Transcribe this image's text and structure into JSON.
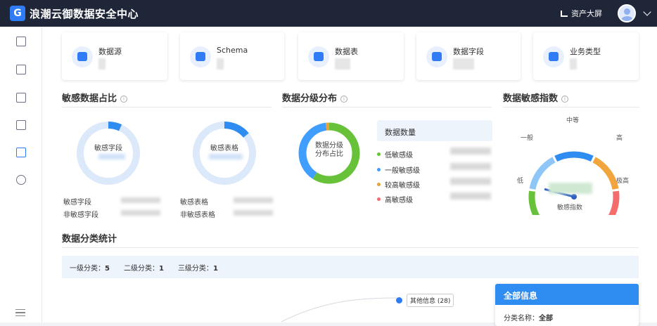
{
  "header": {
    "logo_letter": "G",
    "title": "浪潮云御数据安全中心",
    "big_screen_label": "资产大屏"
  },
  "sidebar": {
    "icons": [
      "dashboard-icon",
      "report-icon",
      "classification-icon",
      "copy-icon",
      "database-icon",
      "settings-icon"
    ],
    "active_index": 4
  },
  "cards": [
    {
      "label": "数据源",
      "icon": "datasource-icon"
    },
    {
      "label": "Schema",
      "icon": "schema-icon"
    },
    {
      "label": "数据表",
      "icon": "table-icon"
    },
    {
      "label": "数据字段",
      "icon": "field-icon"
    },
    {
      "label": "业务类型",
      "icon": "business-type-icon"
    }
  ],
  "sensitive_ratio": {
    "title": "敏感数据占比",
    "field_donut_label": "敏感字段",
    "table_donut_label": "敏感表格",
    "field_ratio": 0.07,
    "table_ratio": 0.14,
    "rows": [
      {
        "label": "敏感字段"
      },
      {
        "label": "非敏感字段"
      },
      {
        "label": "敏感表格"
      },
      {
        "label": "非敏感表格"
      }
    ]
  },
  "classification": {
    "title": "数据分级分布",
    "center_line1": "数据分级",
    "center_line2": "分布占比",
    "count_label": "数据数量",
    "legend": [
      {
        "label": "低敏感级",
        "color": "#67c23a"
      },
      {
        "label": "一般敏感级",
        "color": "#409eff"
      },
      {
        "label": "较高敏感级",
        "color": "#e6a23c"
      },
      {
        "label": "高敏感级",
        "color": "#f56c6c"
      }
    ],
    "slices": [
      {
        "label": "低敏感级",
        "value": 0.59
      },
      {
        "label": "一般敏感级",
        "value": 0.39
      },
      {
        "label": "较高敏感级",
        "value": 0.02
      },
      {
        "label": "高敏感级",
        "value": 0.0
      }
    ]
  },
  "index": {
    "title": "数据敏感指数",
    "scale_labels": [
      "低",
      "一般",
      "中等",
      "高",
      "极高"
    ],
    "bottom_label": "敏感指数",
    "needle_fraction": 0.22
  },
  "stats": {
    "title": "数据分类统计",
    "items": [
      {
        "label": "一级分类：",
        "value": "5"
      },
      {
        "label": "二级分类：",
        "value": "1"
      },
      {
        "label": "三级分类：",
        "value": "1"
      }
    ]
  },
  "tree": {
    "node_label": "其他信息 (28)"
  },
  "info_panel": {
    "title": "全部信息",
    "row_label": "分类名称：",
    "row_value": "全部"
  },
  "colors": {
    "primary": "#2f7cf6",
    "header_bg": "#1f2638"
  }
}
